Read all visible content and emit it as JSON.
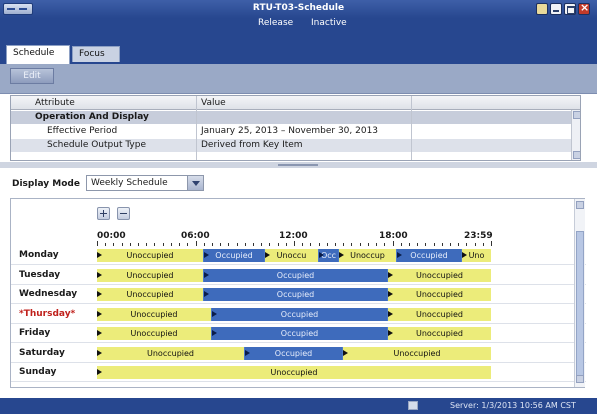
{
  "window": {
    "title": "RTU-T03-Schedule",
    "status": "Release",
    "state": "Inactive"
  },
  "tabs": [
    {
      "label": "Schedule",
      "selected": true
    },
    {
      "label": "Focus",
      "selected": false
    }
  ],
  "toolbar": {
    "edit_label": "Edit"
  },
  "attributes": {
    "header_attribute": "Attribute",
    "header_value": "Value",
    "group": "Operation And Display",
    "rows": [
      {
        "name": "Effective Period",
        "value": "January 25, 2013 – November 30, 2013"
      },
      {
        "name": "Schedule Output Type",
        "value": "Derived from Key Item"
      }
    ]
  },
  "display_mode": {
    "label": "Display Mode",
    "selected": "Weekly Schedule"
  },
  "time_axis": {
    "labels": [
      "00:00",
      "06:00",
      "12:00",
      "18:00",
      "23:59"
    ]
  },
  "schedule": {
    "colors": {
      "unoccupied": "#ecec7a",
      "occupied": "#3e6bbc"
    },
    "days": [
      {
        "name": "Monday",
        "special": false,
        "segments": [
          {
            "state": "unoccupied",
            "start": 0,
            "end": 6.5,
            "label": "Unoccupied"
          },
          {
            "state": "occupied",
            "start": 6.5,
            "end": 10.25,
            "label": "Occupied"
          },
          {
            "state": "unoccupied",
            "start": 10.25,
            "end": 13.5,
            "label": "Unoccu"
          },
          {
            "state": "occupied",
            "start": 13.5,
            "end": 14.75,
            "label": "Occ"
          },
          {
            "state": "unoccupied",
            "start": 14.75,
            "end": 18.25,
            "label": "Unoccup"
          },
          {
            "state": "occupied",
            "start": 18.25,
            "end": 22.25,
            "label": "Occupied"
          },
          {
            "state": "unoccupied",
            "start": 22.25,
            "end": 24,
            "label": "Uno"
          }
        ]
      },
      {
        "name": "Tuesday",
        "special": false,
        "segments": [
          {
            "state": "unoccupied",
            "start": 0,
            "end": 6.5,
            "label": "Unoccupied"
          },
          {
            "state": "occupied",
            "start": 6.5,
            "end": 17.75,
            "label": "Occupied"
          },
          {
            "state": "unoccupied",
            "start": 17.75,
            "end": 24,
            "label": "Unoccupied"
          }
        ]
      },
      {
        "name": "Wednesday",
        "special": false,
        "segments": [
          {
            "state": "unoccupied",
            "start": 0,
            "end": 6.5,
            "label": "Unoccupied"
          },
          {
            "state": "occupied",
            "start": 6.5,
            "end": 17.75,
            "label": "Occupied"
          },
          {
            "state": "unoccupied",
            "start": 17.75,
            "end": 24,
            "label": "Unoccupied"
          }
        ]
      },
      {
        "name": "*Thursday*",
        "special": true,
        "segments": [
          {
            "state": "unoccupied",
            "start": 0,
            "end": 7,
            "label": "Unoccupied"
          },
          {
            "state": "occupied",
            "start": 7,
            "end": 17.75,
            "label": "Occupied"
          },
          {
            "state": "unoccupied",
            "start": 17.75,
            "end": 24,
            "label": "Unoccupied"
          }
        ]
      },
      {
        "name": "Friday",
        "special": false,
        "segments": [
          {
            "state": "unoccupied",
            "start": 0,
            "end": 7,
            "label": "Unoccupied"
          },
          {
            "state": "occupied",
            "start": 7,
            "end": 17.75,
            "label": "Occupied"
          },
          {
            "state": "unoccupied",
            "start": 17.75,
            "end": 24,
            "label": "Unoccupied"
          }
        ]
      },
      {
        "name": "Saturday",
        "special": false,
        "segments": [
          {
            "state": "unoccupied",
            "start": 0,
            "end": 9,
            "label": "Unoccupied"
          },
          {
            "state": "occupied",
            "start": 9,
            "end": 15,
            "label": "Occupied"
          },
          {
            "state": "unoccupied",
            "start": 15,
            "end": 24,
            "label": "Unoccupied"
          }
        ]
      },
      {
        "name": "Sunday",
        "special": false,
        "segments": [
          {
            "state": "unoccupied",
            "start": 0,
            "end": 24,
            "label": "Unoccupied"
          }
        ]
      }
    ]
  },
  "footer": {
    "server_status": "Server: 1/3/2013 10:56 AM CST",
    "server_icon": "server-icon"
  }
}
